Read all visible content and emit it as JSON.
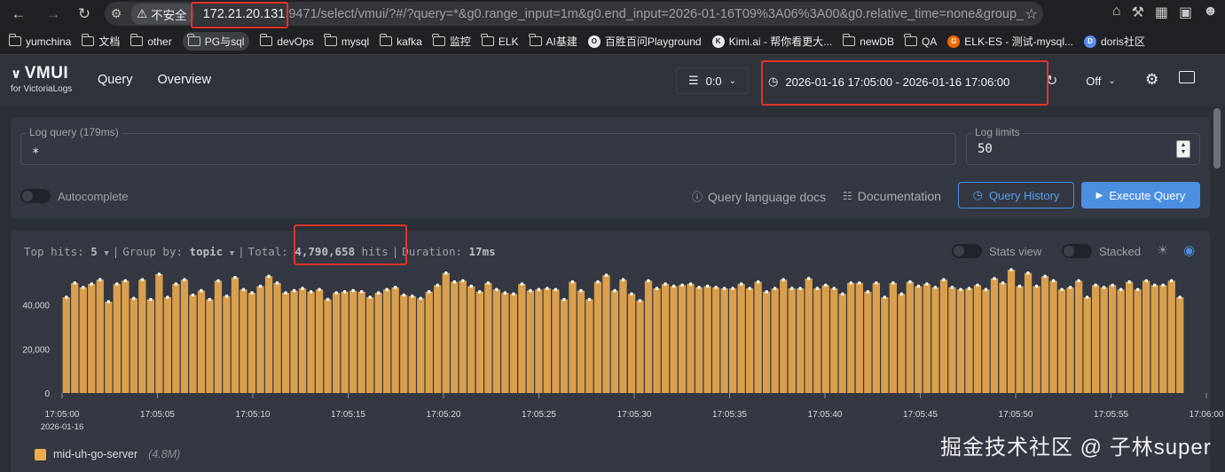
{
  "browser": {
    "address": {
      "insecure_label": "不安全",
      "host": "172.21.20.131",
      "rest": ":9471/select/vmui/?#/?query=*&g0.range_input=1m&g0.end_input=2026-01-16T09%3A06%3A00&g0.relative_time=none&group_"
    },
    "bookmarks": [
      {
        "label": "yumchina",
        "icon": "folder-icon"
      },
      {
        "label": "文档",
        "icon": "folder-icon"
      },
      {
        "label": "other",
        "icon": "folder-icon"
      },
      {
        "label": "PG与sql",
        "icon": "folder-icon"
      },
      {
        "label": "devOps",
        "icon": "folder-icon"
      },
      {
        "label": "mysql",
        "icon": "folder-icon"
      },
      {
        "label": "kafka",
        "icon": "folder-icon"
      },
      {
        "label": "监控",
        "icon": "folder-icon"
      },
      {
        "label": "ELK",
        "icon": "folder-icon"
      },
      {
        "label": "AI基建",
        "icon": "folder-icon"
      },
      {
        "label": "百胜百问Playground",
        "icon": "site-icon"
      },
      {
        "label": "Kimi.ai - 帮你看更大...",
        "icon": "kimi-icon"
      },
      {
        "label": "newDB",
        "icon": "folder-icon"
      },
      {
        "label": "QA",
        "icon": "folder-icon"
      },
      {
        "label": "ELK-ES - 测试-mysql...",
        "icon": "grafana-icon"
      },
      {
        "label": "doris社区",
        "icon": "doris-icon"
      }
    ]
  },
  "header": {
    "logo_main": "VMUI",
    "logo_sub": "for VictoriaLogs",
    "nav": [
      "Query",
      "Overview"
    ],
    "tenant": "0:0",
    "time_range": "2026-01-16 17:05:00 - 2026-01-16 17:06:00",
    "refresh": "Off"
  },
  "query": {
    "log_query_label": "Log query (179ms)",
    "log_query_value": "*",
    "log_limits_label": "Log limits",
    "log_limits_value": "50",
    "autocomplete_label": "Autocomplete",
    "docs_label": "Query language docs",
    "documentation_label": "Documentation",
    "history_button": "Query History",
    "execute_button": "Execute Query"
  },
  "results": {
    "top_hits_label": "Top hits:",
    "top_hits_value": "5",
    "group_by_label": "Group by:",
    "group_by_value": "topic",
    "total_label": "Total:",
    "total_value": "4,790,658",
    "hits_label": "hits",
    "duration_label": "Duration:",
    "duration_value": "17ms",
    "stats_view_label": "Stats view",
    "stacked_label": "Stacked"
  },
  "chart_data": {
    "type": "bar",
    "title": "",
    "xlabel": "",
    "ylabel": "",
    "ylim": [
      0,
      56000
    ],
    "y_ticks": [
      0,
      20000,
      40000
    ],
    "y_tick_labels": [
      "0",
      "20,000",
      "40,000"
    ],
    "x_tick_labels": [
      "17:05:00",
      "17:05:05",
      "17:05:10",
      "17:05:15",
      "17:05:20",
      "17:05:25",
      "17:05:30",
      "17:05:35",
      "17:05:40",
      "17:05:45",
      "17:05:50",
      "17:05:55",
      "17:06:00"
    ],
    "x_date_label": "2026-01-16",
    "bar_color": "#f0ad4e",
    "series": [
      {
        "name": "mid-uh-go-server",
        "legend_count": "(4.8M)",
        "values": [
          43500,
          50000,
          48000,
          49500,
          51500,
          41500,
          49500,
          51000,
          43000,
          51500,
          42500,
          54000,
          43500,
          49500,
          51500,
          44500,
          46500,
          42500,
          51000,
          44000,
          52500,
          47000,
          45500,
          48500,
          53000,
          50000,
          45500,
          46500,
          47500,
          46000,
          47000,
          42500,
          45500,
          46000,
          46500,
          46000,
          43500,
          45500,
          47000,
          48000,
          44500,
          44000,
          43000,
          46000,
          49000,
          54500,
          50500,
          51000,
          48500,
          46000,
          50000,
          47000,
          45500,
          45000,
          49500,
          46500,
          47000,
          47500,
          47000,
          42500,
          50500,
          46500,
          42500,
          50500,
          53500,
          46500,
          51500,
          45000,
          42000,
          51000,
          47500,
          49500,
          48500,
          49000,
          49500,
          48000,
          48500,
          48000,
          47500,
          47500,
          49500,
          47500,
          50500,
          46000,
          47500,
          51500,
          47500,
          47500,
          52000,
          47500,
          49000,
          47500,
          45000,
          50000,
          50000,
          46000,
          50000,
          43500,
          50000,
          45000,
          50500,
          48500,
          49500,
          48000,
          51500,
          48000,
          47000,
          47500,
          49000,
          47000,
          52000,
          50000,
          56000,
          48500,
          54500,
          48500,
          53000,
          51000,
          47000,
          48000,
          51000,
          43500,
          49000,
          48000,
          49000,
          47000,
          50500,
          47000,
          51000,
          49000,
          49000,
          51000,
          43500
        ]
      }
    ]
  },
  "watermark": "掘金技术社区 @ 子林super"
}
